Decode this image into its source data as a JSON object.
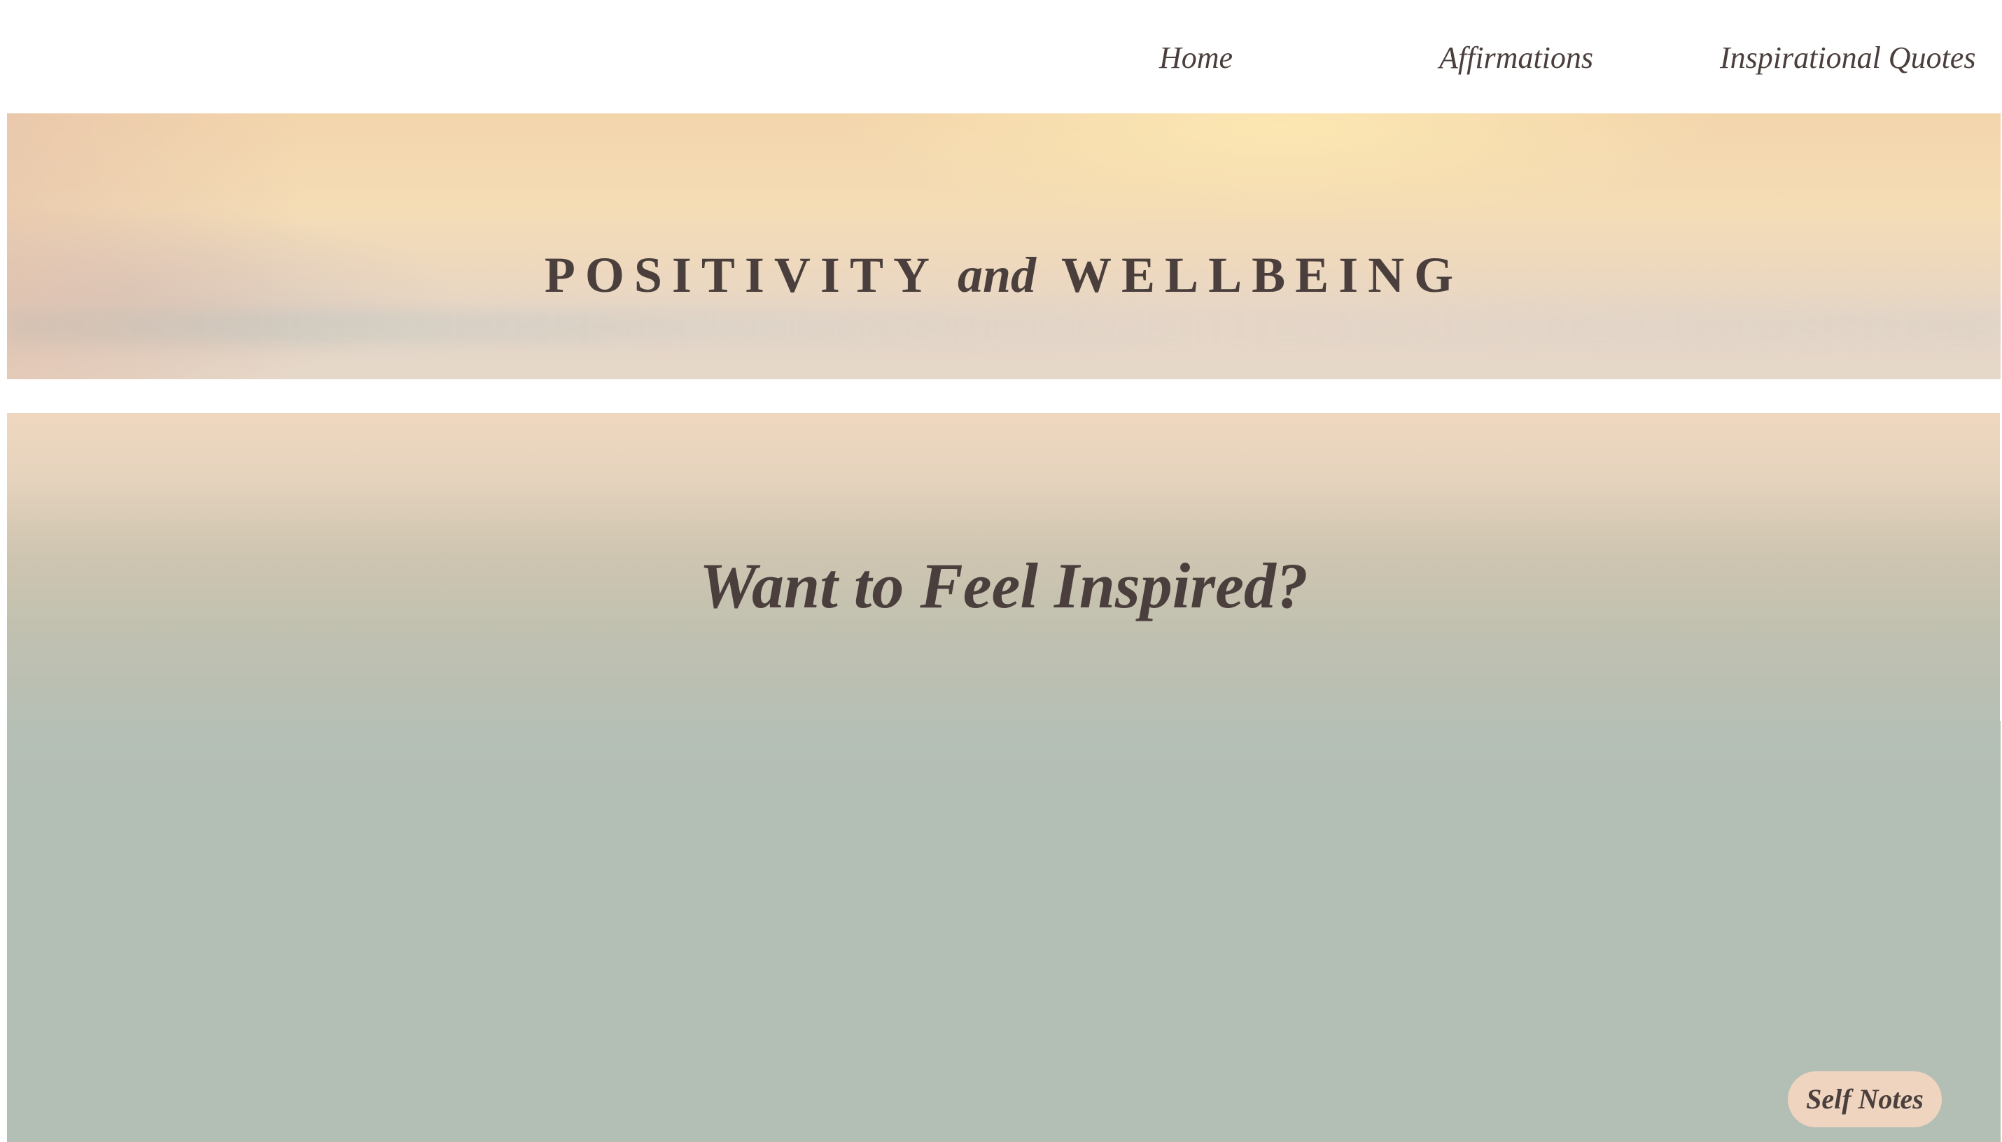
{
  "nav": {
    "items": [
      {
        "label": "Home"
      },
      {
        "label": "Affirmations"
      },
      {
        "label": "Inspirational Quotes"
      }
    ]
  },
  "banner": {
    "title_word_1": "POSITIVITY",
    "title_connector": "and",
    "title_word_2": "WELLBEING"
  },
  "hero": {
    "heading": "Want to Feel Inspired?"
  },
  "self_notes_button": {
    "label": "Self Notes"
  },
  "colors": {
    "text": "#4a3f3c",
    "banner_top": "#f3d5ac",
    "hero_sage": "#b3beb5",
    "button_bg": "#efd4c0"
  }
}
